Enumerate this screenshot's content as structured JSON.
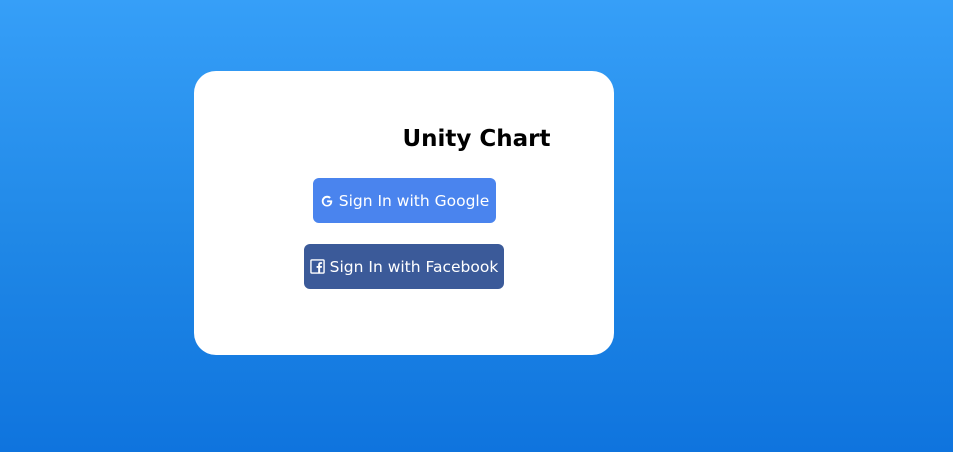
{
  "app": {
    "title": "Unity Chart"
  },
  "buttons": {
    "google": {
      "label": "Sign In with Google",
      "icon": "google-icon",
      "color": "#4a84ee"
    },
    "facebook": {
      "label": "Sign In with Facebook",
      "icon": "facebook-icon",
      "color": "#3b5a99"
    }
  },
  "colors": {
    "background_top": "#369ff8",
    "background_bottom": "#0f74de",
    "card": "#ffffff"
  }
}
